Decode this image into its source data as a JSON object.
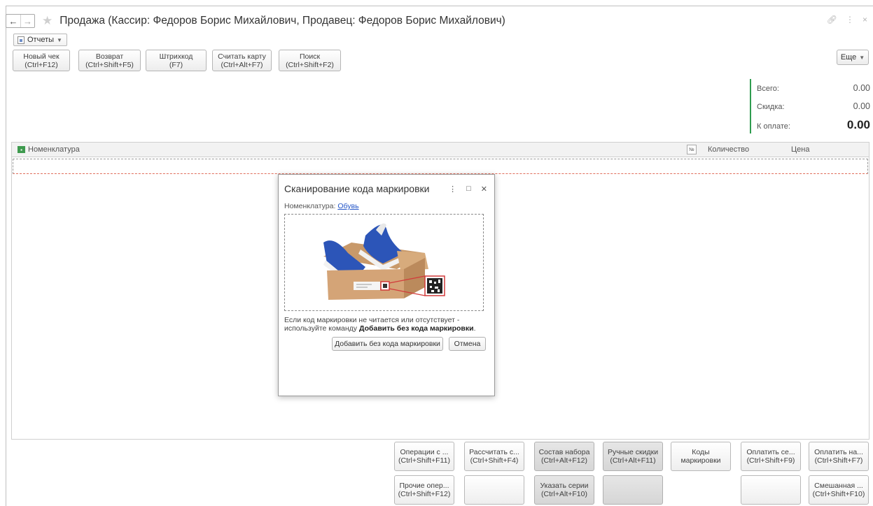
{
  "window": {
    "title": "Продажа (Кассир: Федоров Борис Михайлович, Продавец: Федоров Борис Михайлович)"
  },
  "nav": {
    "back": "←",
    "forward": "→"
  },
  "reports_menu": {
    "label": "Отчеты"
  },
  "toolbar": {
    "buttons": [
      {
        "l1": "Новый чек",
        "l2": "(Ctrl+F12)"
      },
      {
        "l1": "Возврат",
        "l2": "(Ctrl+Shift+F5)"
      },
      {
        "l1": "Штрихкод",
        "l2": "(F7)"
      },
      {
        "l1": "Считать карту",
        "l2": "(Ctrl+Alt+F7)"
      },
      {
        "l1": "Поиск",
        "l2": "(Ctrl+Shift+F2)"
      }
    ],
    "more": "Еще"
  },
  "totals": {
    "total_label": "Всего:",
    "total_value": "0.00",
    "discount_label": "Скидка:",
    "discount_value": "0.00",
    "pay_label": "К оплате:",
    "pay_value": "0.00"
  },
  "table": {
    "col_nomenclature": "Номенклатура",
    "col_num_icon": "№",
    "col_quantity": "Количество",
    "col_price": "Цена"
  },
  "dialog": {
    "title": "Сканирование кода маркировки",
    "nom_label": "Номенклатура:",
    "nom_value": "Обувь",
    "hint_1": "Если код маркировки не читается или отсутствует - используйте команду ",
    "hint_bold": "Добавить без кода маркировки",
    "hint_end": ".",
    "add_without_code": "Добавить без кода маркировки",
    "cancel": "Отмена"
  },
  "bottom_buttons": {
    "row1": [
      {
        "l1": "Операции с ...",
        "l2": "(Ctrl+Shift+F11)",
        "gray": false
      },
      {
        "l1": "Рассчитать с...",
        "l2": "(Ctrl+Shift+F4)",
        "gray": false
      },
      {
        "l1": "Состав набора",
        "l2": "(Ctrl+Alt+F12)",
        "gray": true
      },
      {
        "l1": "Ручные скидки",
        "l2": "(Ctrl+Alt+F11)",
        "gray": true
      },
      {
        "l1": "Коды",
        "l2": "маркировки",
        "gray": false
      },
      {
        "l1": "Оплатить се...",
        "l2": "(Ctrl+Shift+F9)",
        "gray": false
      },
      {
        "l1": "Оплатить на...",
        "l2": "(Ctrl+Shift+F7)",
        "gray": false
      }
    ],
    "row2": [
      {
        "l1": "Прочие опер...",
        "l2": "(Ctrl+Shift+F12)",
        "gray": false
      },
      {
        "l1": "",
        "l2": "",
        "gray": false
      },
      {
        "l1": "Указать серии",
        "l2": "(Ctrl+Alt+F10)",
        "gray": true
      },
      {
        "l1": "",
        "l2": "",
        "gray": true
      },
      {
        "l1": "",
        "l2": "",
        "gray": false
      },
      {
        "l1": "Смешанная ...",
        "l2": "(Ctrl+Shift+F10)",
        "gray": false
      }
    ]
  }
}
